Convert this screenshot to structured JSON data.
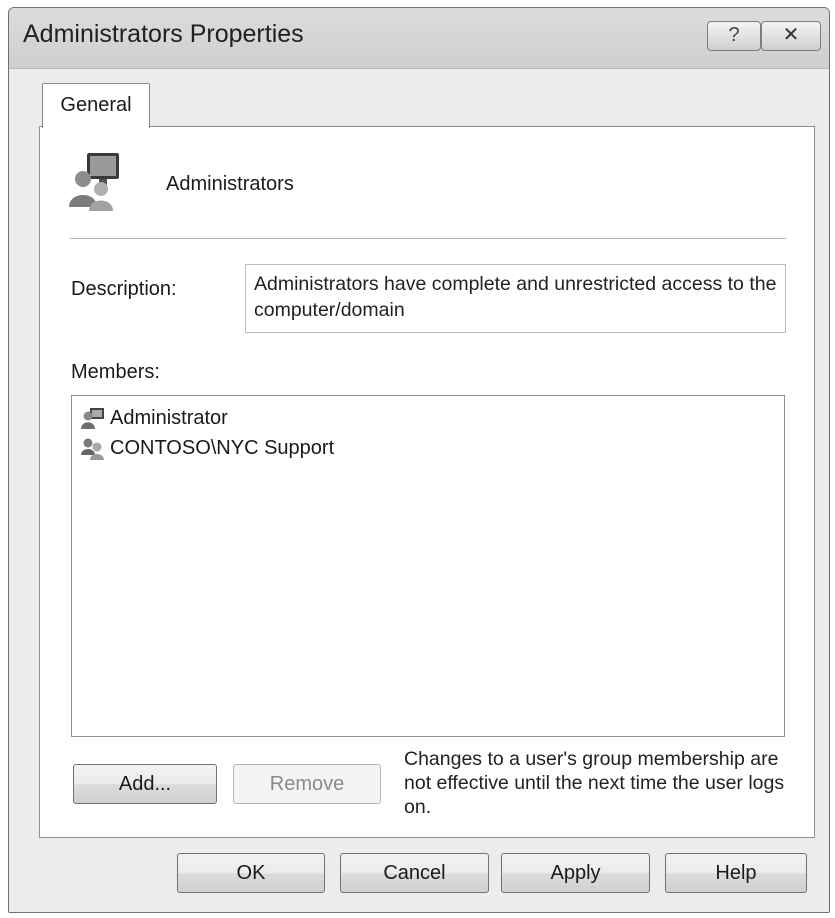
{
  "window": {
    "title": "Administrators Properties",
    "help_glyph": "?",
    "close_glyph": "✕"
  },
  "tabs": [
    {
      "label": "General"
    }
  ],
  "group": {
    "name": "Administrators",
    "icon": "group-icon"
  },
  "description": {
    "label": "Description:",
    "value": "Administrators have complete and unrestricted access to the computer/domain"
  },
  "members": {
    "label": "Members:",
    "items": [
      {
        "name": "Administrator",
        "icon": "user-icon"
      },
      {
        "name": "CONTOSO\\NYC Support",
        "icon": "group-icon"
      }
    ]
  },
  "actions": {
    "add_label": "Add...",
    "remove_label": "Remove",
    "note": "Changes to a user's group membership are not effective until the next time the user logs on."
  },
  "footer": {
    "ok_label": "OK",
    "cancel_label": "Cancel",
    "apply_label": "Apply",
    "help_label": "Help"
  }
}
